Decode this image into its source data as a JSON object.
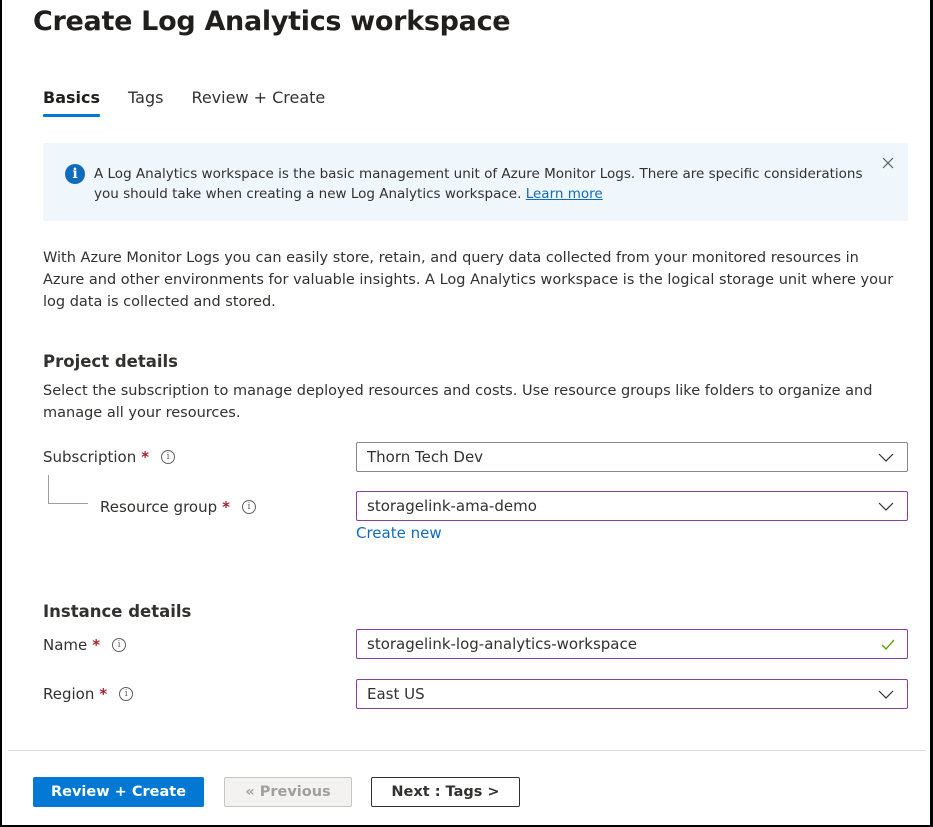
{
  "header": {
    "title": "Create Log Analytics workspace",
    "more_label": "···"
  },
  "tabs": [
    {
      "label": "Basics",
      "active": true
    },
    {
      "label": "Tags",
      "active": false
    },
    {
      "label": "Review + Create",
      "active": false
    }
  ],
  "banner": {
    "icon": "info-icon",
    "text": "A Log Analytics workspace is the basic management unit of Azure Monitor Logs. There are specific considerations you should take when creating a new Log Analytics workspace.",
    "link": "Learn more",
    "close_icon": "close-icon"
  },
  "intro": "With Azure Monitor Logs you can easily store, retain, and query data collected from your monitored resources in Azure and other environments for valuable insights. A Log Analytics workspace is the logical storage unit where your log data is collected and stored.",
  "project_details": {
    "title": "Project details",
    "description": "Select the subscription to manage deployed resources and costs. Use resource groups like folders to organize and manage all your resources.",
    "subscription": {
      "label": "Subscription",
      "required_mark": "*",
      "value": "Thorn Tech Dev"
    },
    "resource_group": {
      "label": "Resource group",
      "required_mark": "*",
      "value": "storagelink-ama-demo",
      "create_new": "Create new"
    }
  },
  "instance_details": {
    "title": "Instance details",
    "name": {
      "label": "Name",
      "required_mark": "*",
      "value": "storagelink-log-analytics-workspace",
      "valid": true
    },
    "region": {
      "label": "Region",
      "required_mark": "*",
      "value": "East US"
    }
  },
  "footer": {
    "review_create": "Review + Create",
    "previous": "« Previous",
    "next": "Next : Tags >"
  },
  "colors": {
    "accent": "#0078d4",
    "required": "#a4262c",
    "focus_border": "#8a3ca8",
    "valid_check": "#57a300",
    "banner_bg": "#eff6fc"
  }
}
